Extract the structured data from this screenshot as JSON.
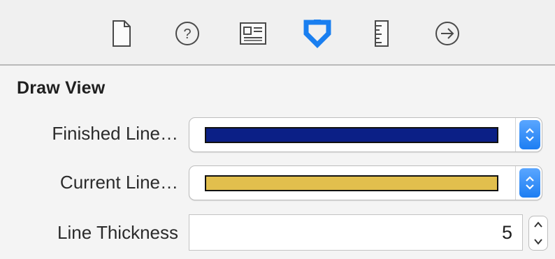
{
  "toolbar": {
    "icons": [
      {
        "name": "file-inspector-icon",
        "selected": false
      },
      {
        "name": "help-inspector-icon",
        "selected": false
      },
      {
        "name": "identity-inspector-icon",
        "selected": false
      },
      {
        "name": "attributes-inspector-icon",
        "selected": true
      },
      {
        "name": "size-inspector-icon",
        "selected": false
      },
      {
        "name": "connections-inspector-icon",
        "selected": false
      }
    ],
    "accent_color": "#1a7ff0"
  },
  "section": {
    "title": "Draw View"
  },
  "properties": {
    "finished_line": {
      "label": "Finished Line…",
      "color": "#0b1f86"
    },
    "current_line": {
      "label": "Current Line…",
      "color": "#e2bf4d"
    },
    "line_thickness": {
      "label": "Line Thickness",
      "value": "5"
    }
  }
}
